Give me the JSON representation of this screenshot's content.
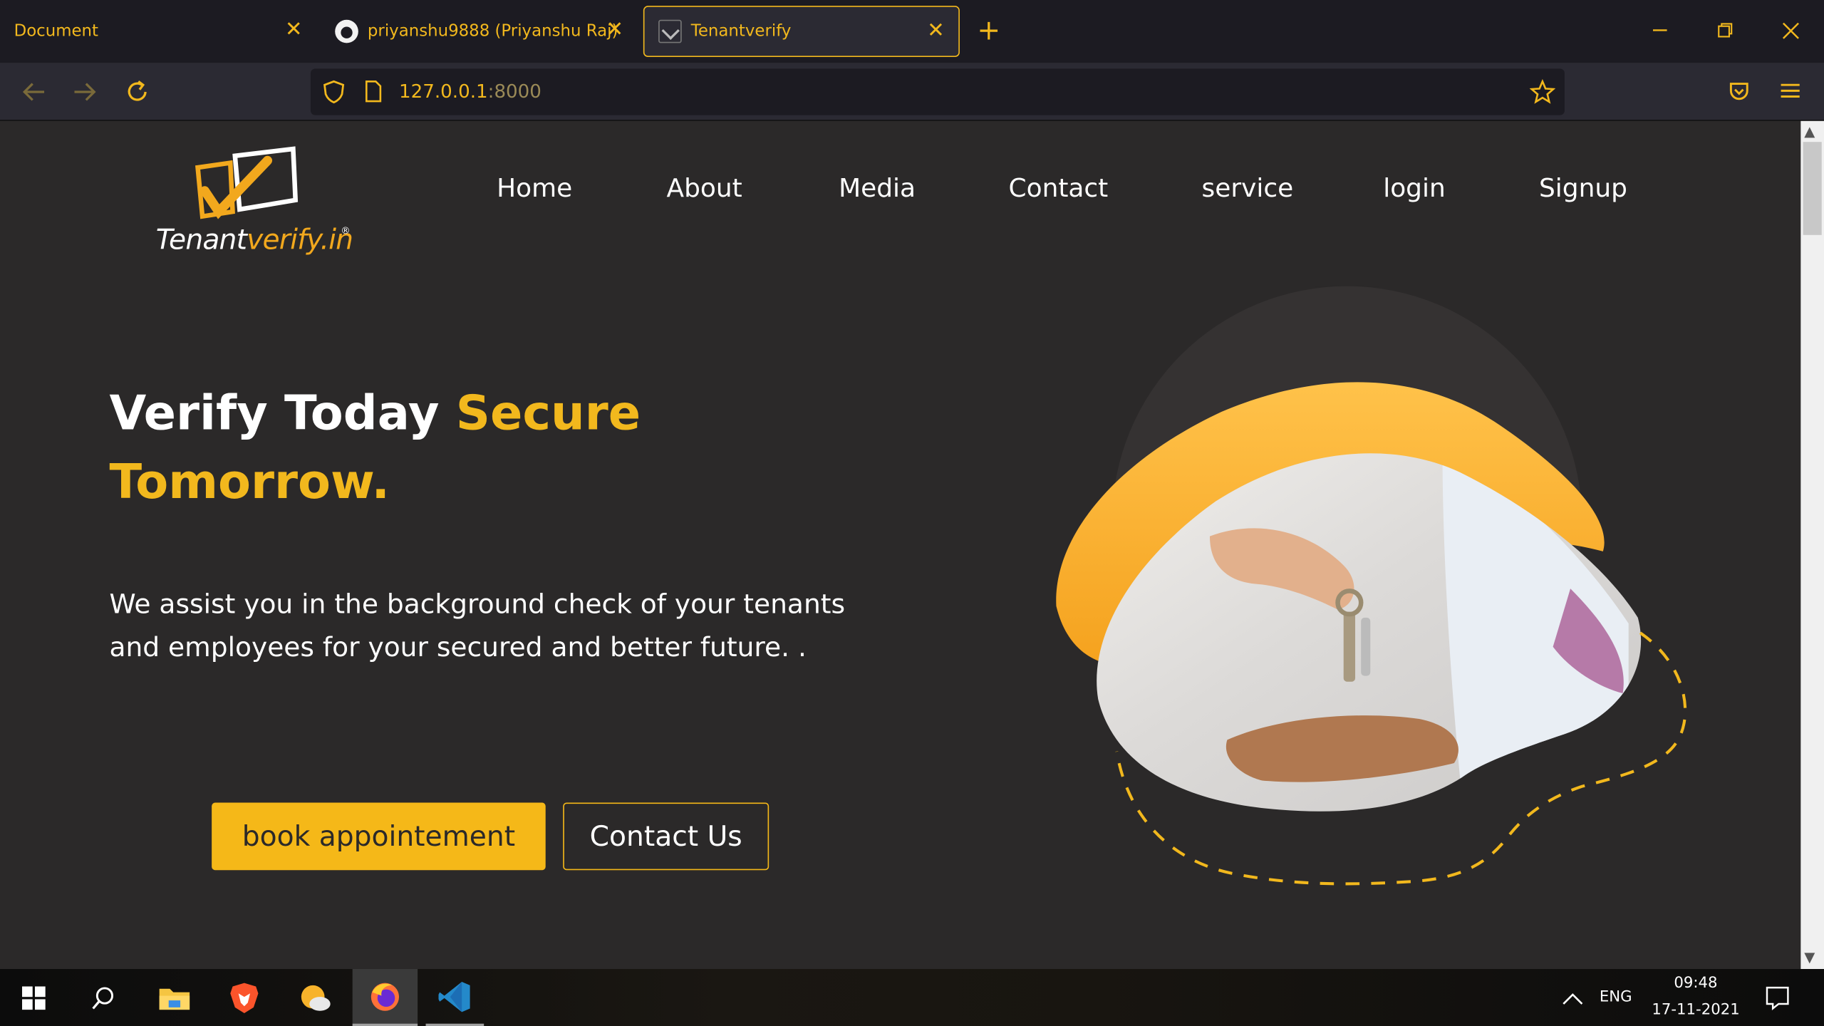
{
  "browser": {
    "tabs": [
      {
        "title": "Document",
        "close": "✕"
      },
      {
        "title": "priyanshu9888 (Priyanshu Raj)",
        "close": "✕"
      },
      {
        "title": "Tenantverify",
        "close": "✕"
      }
    ],
    "new_tab": "+",
    "url_host": "127.0.0.1",
    "url_port": ":8000"
  },
  "site": {
    "logo": {
      "text_main": "Tenant",
      "text_accent": "verify.in",
      "registered": "®"
    },
    "menu": [
      "Home",
      "About",
      "Media",
      "Contact",
      "service",
      "login",
      "Signup"
    ],
    "hero": {
      "title_white": "Verify Today ",
      "title_highlight": "Secure Tomorrow.",
      "subtitle": "We assist you in the background check of your tenants and employees for your secured and better future. .",
      "book_button": "book appointement",
      "contact_button": "Contact Us"
    }
  },
  "taskbar": {
    "language": "ENG",
    "time": "09:48",
    "date": "17-11-2021"
  },
  "colors": {
    "accent": "#f2b81d",
    "page_bg": "#2b2929",
    "button_yellow": "#f5b818"
  }
}
